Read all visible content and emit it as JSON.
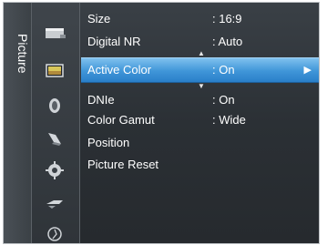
{
  "sidebar": {
    "title": "Picture",
    "icons": [
      "picture-input-icon",
      "picture-icon",
      "sound-icon",
      "channel-icon",
      "setup-icon",
      "input-icon",
      "application-icon"
    ]
  },
  "menu": {
    "items": [
      {
        "label": "Size",
        "value": ": 16:9"
      },
      {
        "label": "Digital NR",
        "value": ": Auto"
      },
      {
        "label": "Active Color",
        "value": ": On"
      },
      {
        "label": "DNIe",
        "value": ": On"
      },
      {
        "label": "Color Gamut",
        "value": ": Wide"
      },
      {
        "label": "Position",
        "value": ""
      },
      {
        "label": "Picture Reset",
        "value": ""
      }
    ],
    "selected_index": 2,
    "up_indicator": "▲",
    "down_indicator": "▼",
    "selected_arrow": "▶"
  },
  "colors": {
    "highlight": "#3f95d8",
    "panel_bg": "#2b3035",
    "text": "#ffffff"
  }
}
